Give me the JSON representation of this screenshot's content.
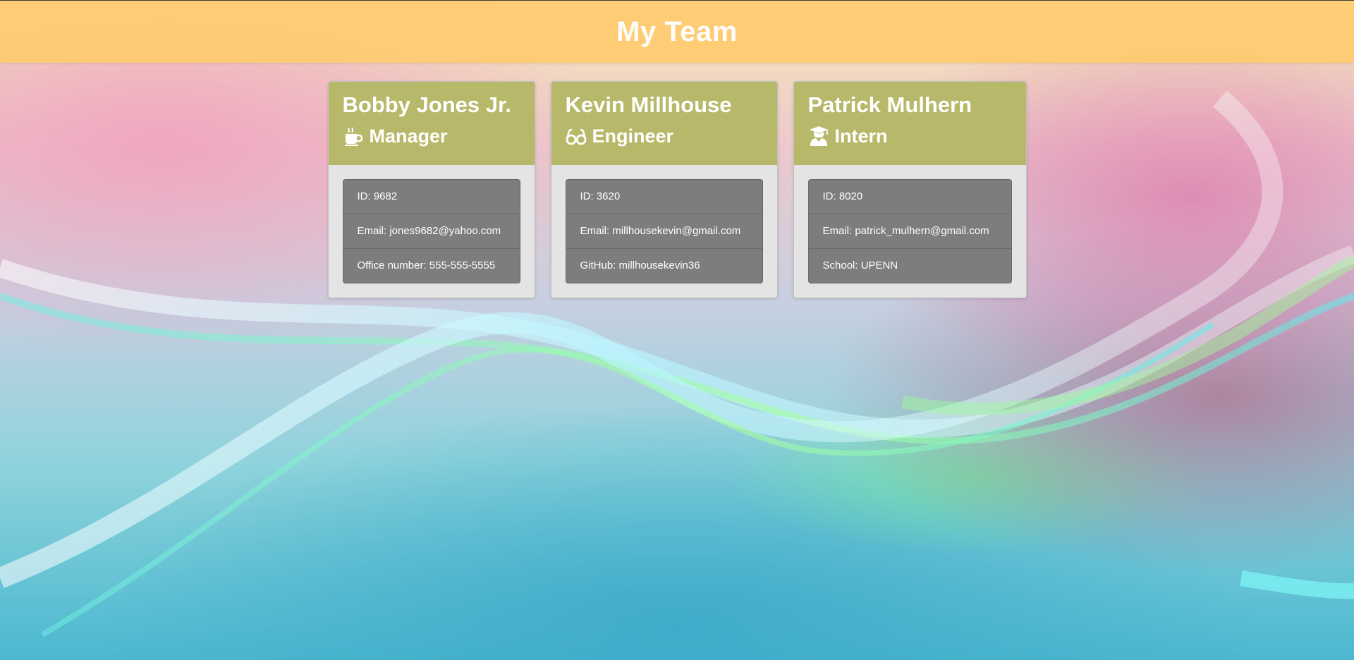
{
  "header": {
    "title": "My Team"
  },
  "team": [
    {
      "name": "Bobby Jones Jr.",
      "role": "Manager",
      "icon": "coffee-mug-icon",
      "id_line": "ID: 9682",
      "email_line": "Email: jones9682@yahoo.com",
      "extra_line": "Office number: 555-555-5555"
    },
    {
      "name": "Kevin Millhouse",
      "role": "Engineer",
      "icon": "glasses-icon",
      "id_line": "ID: 3620",
      "email_line": "Email: millhousekevin@gmail.com",
      "extra_line": "GitHub: millhousekevin36"
    },
    {
      "name": "Patrick Mulhern",
      "role": "Intern",
      "icon": "graduate-icon",
      "id_line": "ID: 8020",
      "email_line": "Email: patrick_mulhern@gmail.com",
      "extra_line": "School: UPENN"
    }
  ],
  "colors": {
    "header_bg": "#ffcc73",
    "card_header_bg": "#b8b86a",
    "card_body_bg": "#e4e4e4",
    "list_bg": "#7d7d7d"
  }
}
